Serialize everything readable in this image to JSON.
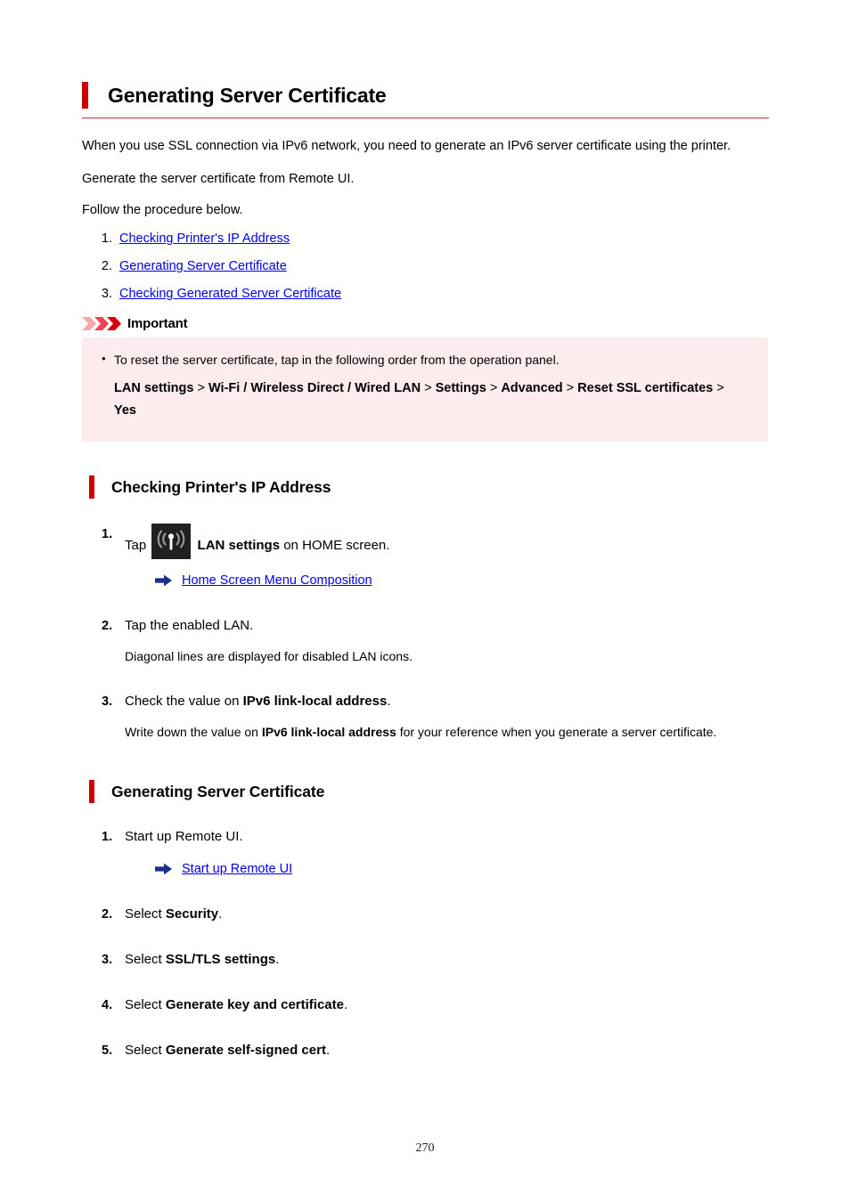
{
  "document": {
    "title": "Generating Server Certificate",
    "page_number": "270",
    "accent_color": "#cc0000",
    "link_color": "#0000ee",
    "callout_bg_color": "#fdeced",
    "arrow_icon_color": "#1a2f8f"
  },
  "intro": {
    "paragraph_1": "When you use SSL connection via IPv6 network, you need to generate an IPv6 server certificate using the printer.",
    "paragraph_2": "Generate the server certificate from Remote UI.",
    "paragraph_3": "Follow the procedure below."
  },
  "procedure_links": [
    {
      "label": "Checking Printer's IP Address"
    },
    {
      "label": "Generating Server Certificate"
    },
    {
      "label": "Checking Generated Server Certificate"
    }
  ],
  "important": {
    "icon": "triple-chevron-icon",
    "label": "Important",
    "bullet_text": "To reset the server certificate, tap in the following order from the operation panel.",
    "path_segments": [
      {
        "text": "LAN settings",
        "bold": true
      },
      {
        "text": " > ",
        "bold": false
      },
      {
        "text": "Wi-Fi / Wireless Direct / Wired LAN",
        "bold": true
      },
      {
        "text": " > ",
        "bold": false
      },
      {
        "text": "Settings",
        "bold": true
      },
      {
        "text": " > ",
        "bold": false
      },
      {
        "text": "Advanced",
        "bold": true
      },
      {
        "text": " > ",
        "bold": false
      },
      {
        "text": "Reset SSL certificates",
        "bold": true
      },
      {
        "text": " > ",
        "bold": false
      },
      {
        "text": "Yes",
        "bold": true
      }
    ]
  },
  "section_ip": {
    "heading": "Checking Printer's IP Address",
    "step1": {
      "prefix": "Tap",
      "icon": "lan-settings-icon",
      "bold": "LAN settings",
      "suffix": "on HOME screen.",
      "see_also_icon": "arrow-right-icon",
      "see_also_link": "Home Screen Menu Composition"
    },
    "step2": {
      "text": "Tap the enabled LAN.",
      "note": "Diagonal lines are displayed for disabled LAN icons."
    },
    "step3": {
      "prefix": "Check the value on",
      "bold": "IPv6 link-local address",
      "suffix": ".",
      "note_part1": "Write down the value on",
      "note_bold": "IPv6 link-local address",
      "note_part2": "for your reference when you generate a server certificate."
    }
  },
  "section_gen": {
    "heading": "Generating Server Certificate",
    "step1": {
      "text": "Start up Remote UI.",
      "see_also_icon": "arrow-right-icon",
      "see_also_link": "Start up Remote UI"
    },
    "step2": {
      "prefix": "Select",
      "bold": "Security",
      "suffix": "."
    },
    "step3": {
      "prefix": "Select",
      "bold": "SSL/TLS settings",
      "suffix": "."
    },
    "step4": {
      "prefix": "Select",
      "bold": "Generate key and certificate",
      "suffix": "."
    },
    "step5": {
      "prefix": "Select",
      "bold": "Generate self-signed cert",
      "suffix": "."
    }
  }
}
